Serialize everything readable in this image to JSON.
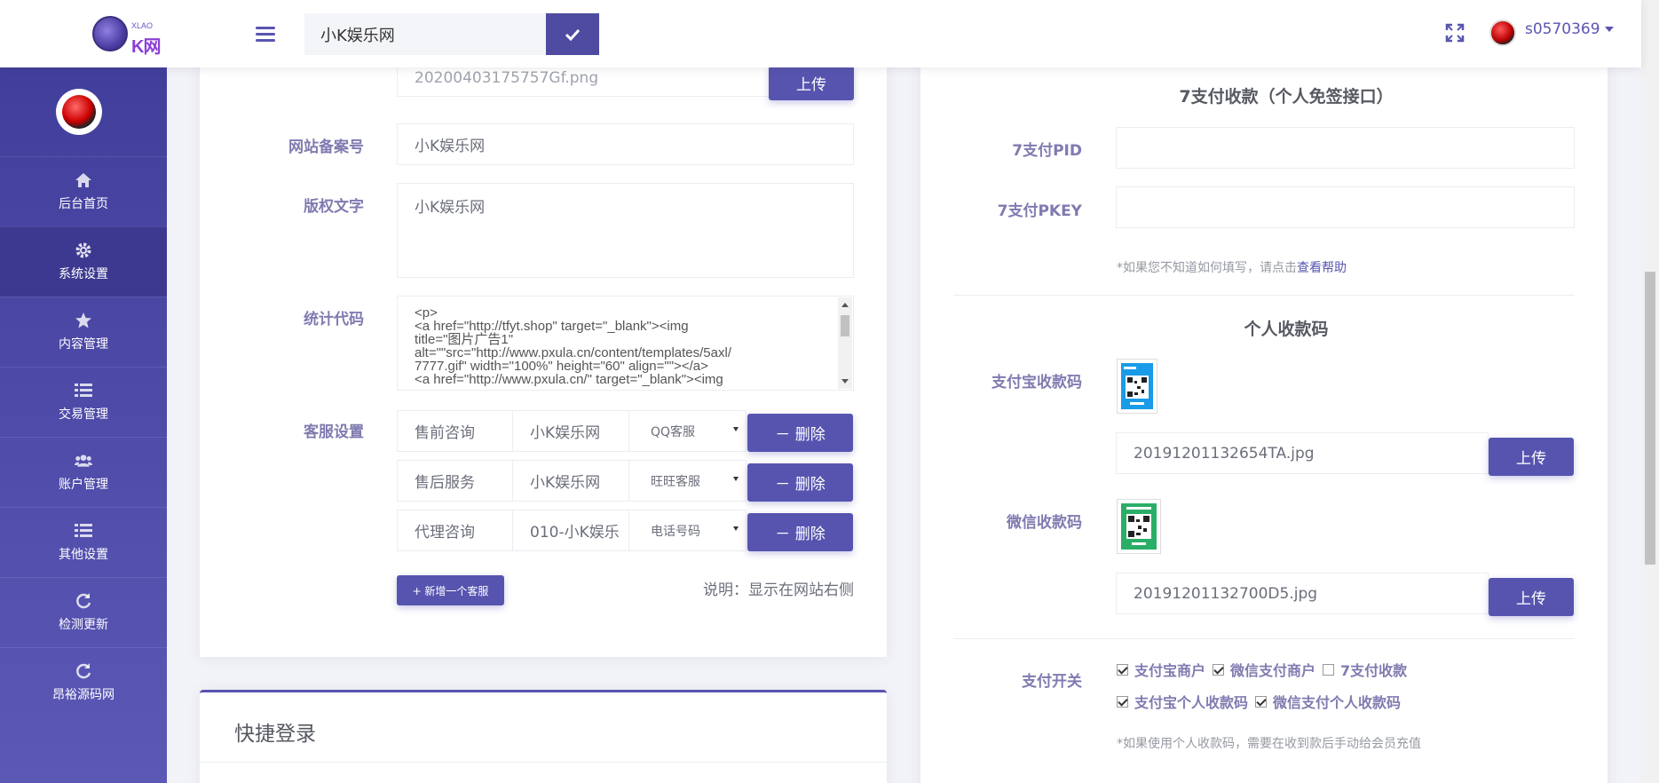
{
  "header": {
    "search_value": "小K娱乐网",
    "user_name": "s0570369"
  },
  "sidebar": {
    "items": [
      {
        "label": "后台首页",
        "icon": "home-icon"
      },
      {
        "label": "系统设置",
        "icon": "gear-icon"
      },
      {
        "label": "内容管理",
        "icon": "star-icon"
      },
      {
        "label": "交易管理",
        "icon": "list-icon"
      },
      {
        "label": "账户管理",
        "icon": "users-icon"
      },
      {
        "label": "其他设置",
        "icon": "list-icon"
      },
      {
        "label": "检测更新",
        "icon": "refresh-icon"
      },
      {
        "label": "昂裕源码网",
        "icon": "refresh-icon"
      }
    ],
    "active": "系统设置"
  },
  "site_settings": {
    "logo_file": "20200403175757Gf.png",
    "upload_label": "上传",
    "icp_label": "网站备案号",
    "icp_value": "小K娱乐网",
    "copyright_label": "版权文字",
    "copyright_value": "小K娱乐网",
    "stats_label": "统计代码",
    "stats_code": "<p>\n<a href=\"http://tfyt.shop\" target=\"_blank\"><img\ntitle=\"图片广告1\"\nalt=\"\"src=\"http://www.pxula.cn/content/templates/5axl/\n7777.gif\" width=\"100%\" height=\"60\" align=\"\"></a>\n<a href=\"http://www.pxula.cn/\" target=\"_blank\"><img",
    "cs_label": "客服设置",
    "cs_rows": [
      {
        "title": "售前咨询",
        "value": "小K娱乐网",
        "type": "QQ客服"
      },
      {
        "title": "售后服务",
        "value": "小K娱乐网",
        "type": "旺旺客服"
      },
      {
        "title": "代理咨询",
        "value": "010-小K娱乐",
        "type": "电话号码"
      }
    ],
    "delete_label": "－ 删除",
    "add_label": "+ 新增一个客服",
    "cs_note": "说明：显示在网站右侧"
  },
  "quick_login": {
    "title": "快捷登录"
  },
  "payment": {
    "seven_title": "7支付收款（个人免签接口）",
    "pid_label": "7支付PID",
    "pid_value": "",
    "pkey_label": "7支付PKEY",
    "pkey_value": "",
    "hint_prefix": "*如果您不知道如何填写，请点击",
    "hint_link": "查看帮助",
    "personal_title": "个人收款码",
    "alipay_label": "支付宝收款码",
    "alipay_file": "20191201132654TA.jpg",
    "wechat_label": "微信收款码",
    "wechat_file": "20191201132700D5.jpg",
    "upload_label": "上传",
    "switch_label": "支付开关",
    "switches": [
      {
        "label": "支付宝商户",
        "checked": true
      },
      {
        "label": "微信支付商户",
        "checked": true
      },
      {
        "label": "7支付收款",
        "checked": false
      },
      {
        "label": "支付宝个人收款码",
        "checked": true
      },
      {
        "label": "微信支付个人收款码",
        "checked": true
      }
    ],
    "bottom_hint": "*如果使用个人收款码，需要在收到款后手动给会员充值"
  },
  "colors": {
    "primary": "#5754b0",
    "sidebar_top": "#423e9c",
    "label": "#7f7bb0"
  }
}
